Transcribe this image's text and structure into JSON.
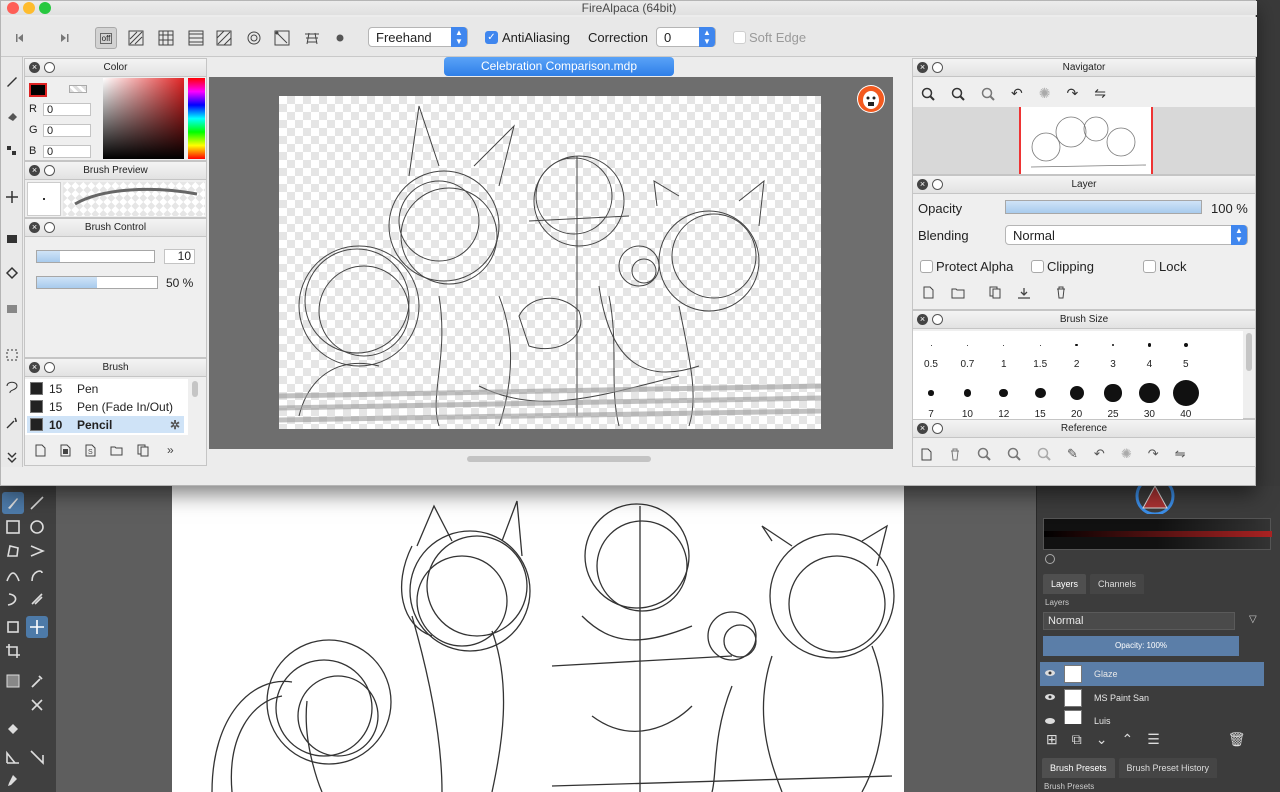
{
  "fa": {
    "title": "FireAlpaca (64bit)",
    "toolbar": {
      "mode_select": "Freehand",
      "antialiasing_label": "AntiAliasing",
      "antialiasing_checked": true,
      "correction_label": "Correction",
      "correction_value": "0",
      "soft_edge_label": "Soft Edge",
      "snap_off_label": "off"
    },
    "color_panel": {
      "title": "Color",
      "r_label": "R",
      "g_label": "G",
      "b_label": "B",
      "r": "0",
      "g": "0",
      "b": "0",
      "primary_color": "#000000"
    },
    "brush_preview_panel": {
      "title": "Brush Preview"
    },
    "brush_control_panel": {
      "title": "Brush Control",
      "size_value": "10",
      "opacity_value": "50 %",
      "size_fraction": 0.2,
      "opacity_fraction": 0.5
    },
    "brush_panel": {
      "title": "Brush",
      "items": [
        {
          "size": "15",
          "name": "Pen"
        },
        {
          "size": "15",
          "name": "Pen (Fade In/Out)"
        },
        {
          "size": "10",
          "name": "Pencil"
        }
      ]
    },
    "document_tab": "Celebration Comparison.mdp",
    "navigator_panel": {
      "title": "Navigator"
    },
    "layer_panel": {
      "title": "Layer",
      "opacity_label": "Opacity",
      "opacity_value": "100 %",
      "blending_label": "Blending",
      "blending_value": "Normal",
      "protect_alpha_label": "Protect Alpha",
      "clipping_label": "Clipping",
      "lock_label": "Lock"
    },
    "brush_size_panel": {
      "title": "Brush Size",
      "sizes_row1": [
        "0.5",
        "0.7",
        "1",
        "1.5",
        "2",
        "3",
        "4",
        "5"
      ],
      "sizes_row2": [
        "7",
        "10",
        "12",
        "15",
        "20",
        "25",
        "30",
        "40"
      ]
    },
    "reference_panel": {
      "title": "Reference"
    }
  },
  "krita": {
    "tabs": [
      "Layers",
      "Channels"
    ],
    "layers_label": "Layers",
    "blend_mode": "Normal",
    "opacity_label": "Opacity:  100%",
    "layers": [
      "Glaze",
      "MS Paint San",
      "Luis"
    ],
    "bottom_tabs": [
      "Brush Presets",
      "Brush Preset History"
    ],
    "brush_presets_label": "Brush Presets",
    "accent_color": "#5b7ea8"
  }
}
